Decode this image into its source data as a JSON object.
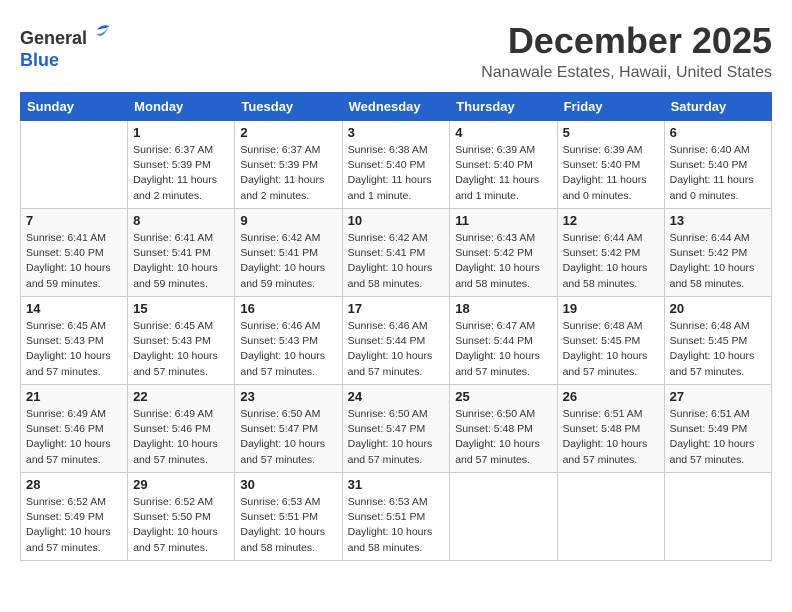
{
  "logo": {
    "general": "General",
    "blue": "Blue"
  },
  "header": {
    "month": "December 2025",
    "location": "Nanawale Estates, Hawaii, United States"
  },
  "weekdays": [
    "Sunday",
    "Monday",
    "Tuesday",
    "Wednesday",
    "Thursday",
    "Friday",
    "Saturday"
  ],
  "weeks": [
    [
      {
        "day": "",
        "info": ""
      },
      {
        "day": "1",
        "info": "Sunrise: 6:37 AM\nSunset: 5:39 PM\nDaylight: 11 hours\nand 2 minutes."
      },
      {
        "day": "2",
        "info": "Sunrise: 6:37 AM\nSunset: 5:39 PM\nDaylight: 11 hours\nand 2 minutes."
      },
      {
        "day": "3",
        "info": "Sunrise: 6:38 AM\nSunset: 5:40 PM\nDaylight: 11 hours\nand 1 minute."
      },
      {
        "day": "4",
        "info": "Sunrise: 6:39 AM\nSunset: 5:40 PM\nDaylight: 11 hours\nand 1 minute."
      },
      {
        "day": "5",
        "info": "Sunrise: 6:39 AM\nSunset: 5:40 PM\nDaylight: 11 hours\nand 0 minutes."
      },
      {
        "day": "6",
        "info": "Sunrise: 6:40 AM\nSunset: 5:40 PM\nDaylight: 11 hours\nand 0 minutes."
      }
    ],
    [
      {
        "day": "7",
        "info": "Sunrise: 6:41 AM\nSunset: 5:40 PM\nDaylight: 10 hours\nand 59 minutes."
      },
      {
        "day": "8",
        "info": "Sunrise: 6:41 AM\nSunset: 5:41 PM\nDaylight: 10 hours\nand 59 minutes."
      },
      {
        "day": "9",
        "info": "Sunrise: 6:42 AM\nSunset: 5:41 PM\nDaylight: 10 hours\nand 59 minutes."
      },
      {
        "day": "10",
        "info": "Sunrise: 6:42 AM\nSunset: 5:41 PM\nDaylight: 10 hours\nand 58 minutes."
      },
      {
        "day": "11",
        "info": "Sunrise: 6:43 AM\nSunset: 5:42 PM\nDaylight: 10 hours\nand 58 minutes."
      },
      {
        "day": "12",
        "info": "Sunrise: 6:44 AM\nSunset: 5:42 PM\nDaylight: 10 hours\nand 58 minutes."
      },
      {
        "day": "13",
        "info": "Sunrise: 6:44 AM\nSunset: 5:42 PM\nDaylight: 10 hours\nand 58 minutes."
      }
    ],
    [
      {
        "day": "14",
        "info": "Sunrise: 6:45 AM\nSunset: 5:43 PM\nDaylight: 10 hours\nand 57 minutes."
      },
      {
        "day": "15",
        "info": "Sunrise: 6:45 AM\nSunset: 5:43 PM\nDaylight: 10 hours\nand 57 minutes."
      },
      {
        "day": "16",
        "info": "Sunrise: 6:46 AM\nSunset: 5:43 PM\nDaylight: 10 hours\nand 57 minutes."
      },
      {
        "day": "17",
        "info": "Sunrise: 6:46 AM\nSunset: 5:44 PM\nDaylight: 10 hours\nand 57 minutes."
      },
      {
        "day": "18",
        "info": "Sunrise: 6:47 AM\nSunset: 5:44 PM\nDaylight: 10 hours\nand 57 minutes."
      },
      {
        "day": "19",
        "info": "Sunrise: 6:48 AM\nSunset: 5:45 PM\nDaylight: 10 hours\nand 57 minutes."
      },
      {
        "day": "20",
        "info": "Sunrise: 6:48 AM\nSunset: 5:45 PM\nDaylight: 10 hours\nand 57 minutes."
      }
    ],
    [
      {
        "day": "21",
        "info": "Sunrise: 6:49 AM\nSunset: 5:46 PM\nDaylight: 10 hours\nand 57 minutes."
      },
      {
        "day": "22",
        "info": "Sunrise: 6:49 AM\nSunset: 5:46 PM\nDaylight: 10 hours\nand 57 minutes."
      },
      {
        "day": "23",
        "info": "Sunrise: 6:50 AM\nSunset: 5:47 PM\nDaylight: 10 hours\nand 57 minutes."
      },
      {
        "day": "24",
        "info": "Sunrise: 6:50 AM\nSunset: 5:47 PM\nDaylight: 10 hours\nand 57 minutes."
      },
      {
        "day": "25",
        "info": "Sunrise: 6:50 AM\nSunset: 5:48 PM\nDaylight: 10 hours\nand 57 minutes."
      },
      {
        "day": "26",
        "info": "Sunrise: 6:51 AM\nSunset: 5:48 PM\nDaylight: 10 hours\nand 57 minutes."
      },
      {
        "day": "27",
        "info": "Sunrise: 6:51 AM\nSunset: 5:49 PM\nDaylight: 10 hours\nand 57 minutes."
      }
    ],
    [
      {
        "day": "28",
        "info": "Sunrise: 6:52 AM\nSunset: 5:49 PM\nDaylight: 10 hours\nand 57 minutes."
      },
      {
        "day": "29",
        "info": "Sunrise: 6:52 AM\nSunset: 5:50 PM\nDaylight: 10 hours\nand 57 minutes."
      },
      {
        "day": "30",
        "info": "Sunrise: 6:53 AM\nSunset: 5:51 PM\nDaylight: 10 hours\nand 58 minutes."
      },
      {
        "day": "31",
        "info": "Sunrise: 6:53 AM\nSunset: 5:51 PM\nDaylight: 10 hours\nand 58 minutes."
      },
      {
        "day": "",
        "info": ""
      },
      {
        "day": "",
        "info": ""
      },
      {
        "day": "",
        "info": ""
      }
    ]
  ]
}
